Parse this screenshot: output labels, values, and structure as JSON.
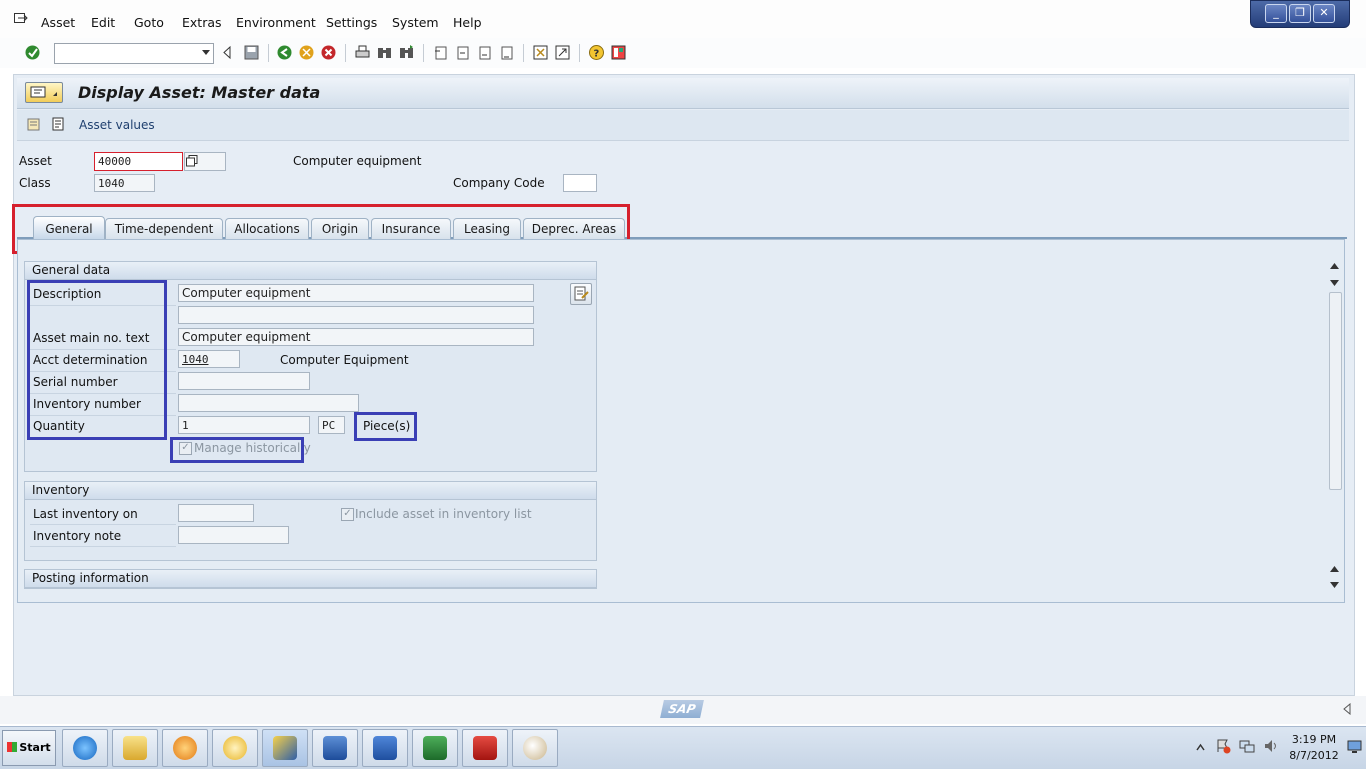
{
  "menu": {
    "items": [
      "Asset",
      "Edit",
      "Goto",
      "Extras",
      "Environment",
      "Settings",
      "System",
      "Help"
    ]
  },
  "window_controls": {
    "minimize": "_",
    "restore": "❐",
    "close": "✕"
  },
  "title": "Display Asset:  Master data",
  "app_toolbar": {
    "asset_values_label": "Asset values"
  },
  "header": {
    "asset_label": "Asset",
    "asset_value": "40000",
    "asset_description": "Computer equipment",
    "class_label": "Class",
    "class_value": "1040",
    "company_code_label": "Company Code",
    "company_code_value": ""
  },
  "tabs": [
    {
      "label": "General",
      "active": true
    },
    {
      "label": "Time-dependent",
      "active": false
    },
    {
      "label": "Allocations",
      "active": false
    },
    {
      "label": "Origin",
      "active": false
    },
    {
      "label": "Insurance",
      "active": false
    },
    {
      "label": "Leasing",
      "active": false
    },
    {
      "label": "Deprec. Areas",
      "active": false
    }
  ],
  "general_data": {
    "heading": "General data",
    "description_label": "Description",
    "description_value": "Computer equipment",
    "description_value2": "",
    "main_text_label": "Asset main no. text",
    "main_text_value": "Computer equipment",
    "acct_label": "Acct determination",
    "acct_value": "1040",
    "acct_text": "Computer Equipment",
    "serial_label": "Serial number",
    "serial_value": "",
    "inventory_no_label": "Inventory number",
    "inventory_no_value": "",
    "quantity_label": "Quantity",
    "quantity_value": "1",
    "unit_value": "PC",
    "unit_text": "Piece(s)",
    "manage_hist_label": "Manage historically",
    "manage_hist_checked": true
  },
  "inventory": {
    "heading": "Inventory",
    "last_inv_label": "Last inventory on",
    "last_inv_value": "",
    "include_label": "Include asset in inventory list",
    "include_checked": true,
    "note_label": "Inventory note",
    "note_value": ""
  },
  "posting_info": {
    "heading": "Posting information"
  },
  "status": {
    "sap_logo": "SAP"
  },
  "taskbar": {
    "start_label": "Start",
    "apps": [
      "internet-explorer",
      "file-explorer",
      "media-player",
      "outlook",
      "sap-logon",
      "sap-gui",
      "word",
      "excel",
      "acrobat",
      "paint"
    ],
    "time": "3:19 PM",
    "date": "8/7/2012"
  },
  "colors": {
    "highlight_red": "#d6202d",
    "highlight_blue": "#3a3fb5",
    "sap_blue": "#7f9dbb"
  }
}
